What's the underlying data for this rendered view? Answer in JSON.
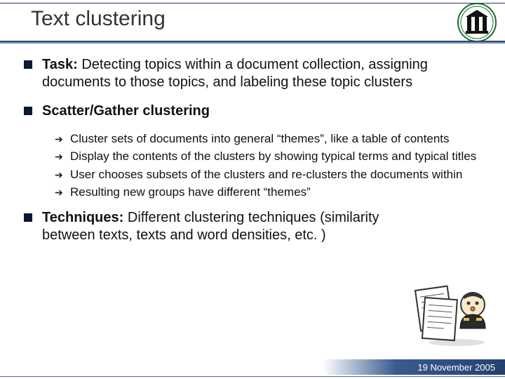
{
  "title": "Text clustering",
  "bullets": [
    {
      "label": "Task:",
      "text": " Detecting topics within a document collection, assigning documents to those topics, and labeling these topic clusters"
    },
    {
      "label": "Scatter/Gather clustering",
      "text": ""
    },
    {
      "label": "Techniques:",
      "text": " Different clustering techniques (similarity between texts, texts and word densities, etc. )"
    }
  ],
  "sub_bullets": [
    "Cluster sets of documents into general “themes”, like a table of contents",
    "Display the contents of the clusters by showing typical terms and typical titles",
    "User chooses subsets of the clusters and re-clusters the documents within",
    "Resulting new groups have different “themes”"
  ],
  "footer_date": "19 November 2005"
}
